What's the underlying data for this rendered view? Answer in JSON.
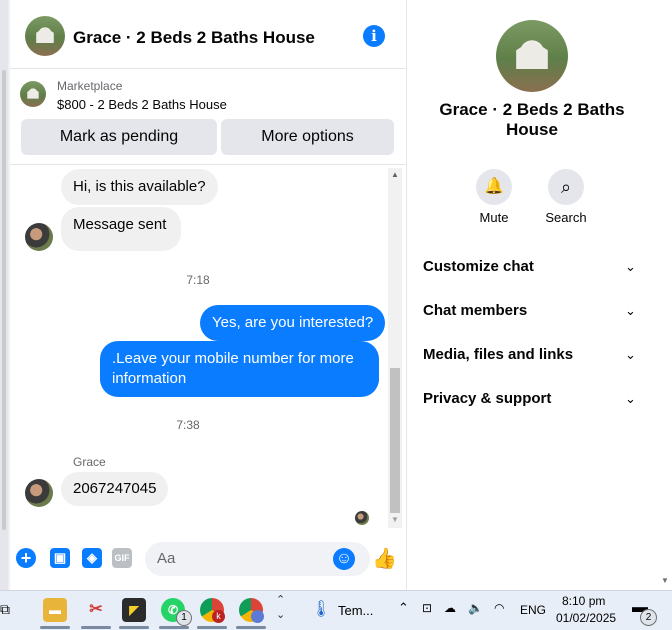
{
  "header": {
    "title": "Grace · 2 Beds 2 Baths House",
    "info_icon": "i"
  },
  "listing": {
    "source": "Marketplace",
    "item": "$800 - 2 Beds 2 Baths House",
    "mark_pending": "Mark as pending",
    "more_options": "More options"
  },
  "messages": {
    "in1": "Hi, is this available?",
    "in2": "Message sent",
    "time1": "7:18",
    "out1": "Yes, are you interested?",
    "out2": ".Leave your mobile number for more information",
    "time2": "7:38",
    "sender": "Grace",
    "in3": "2067247045"
  },
  "composer": {
    "placeholder": "Aa",
    "gif": "GIF",
    "emoji": "☺",
    "like": "👍"
  },
  "side": {
    "title": "Grace · 2 Beds 2 Baths House",
    "mute_label": "Mute",
    "search_label": "Search",
    "menu": [
      "Customize chat",
      "Chat members",
      "Media, files and links",
      "Privacy & support"
    ]
  },
  "taskbar": {
    "temp_label": "Tem...",
    "lang": "ENG",
    "time": "8:10 pm",
    "date": "01/02/2025",
    "notif_count": "2",
    "whatsapp_badge": "1",
    "chrome_k": "k"
  },
  "icons": {
    "info": "info-icon",
    "bell": "bell-icon",
    "search": "search-icon",
    "chevron": "chevron-down-icon",
    "plus": "plus-icon",
    "image": "image-icon",
    "sticker": "sticker-icon",
    "gif": "gif-icon",
    "emoji": "emoji-icon",
    "like": "thumbs-up-icon"
  },
  "colors": {
    "accent": "#0a7cff",
    "bubble_in": "#f0f0f0",
    "text_secondary": "#65676b"
  }
}
